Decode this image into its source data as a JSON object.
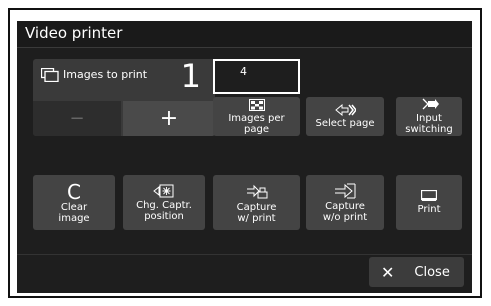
{
  "window": {
    "title": "Video printer"
  },
  "counter": {
    "label": "Images to print",
    "value": "1",
    "minus": "−",
    "plus": "+"
  },
  "images_per_page_value": "4",
  "buttons": {
    "images_per_page": "Images per\npage",
    "select_page": "Select page",
    "input_switching": "Input\nswitching",
    "clear_image_big": "C",
    "clear_image": "Clear\nimage",
    "chg_captr": "Chg. Captr.\nposition",
    "capture_print": "Capture\nw/ print",
    "capture_no_print": "Capture\nw/o print",
    "print": "Print"
  },
  "close": {
    "icon": "✕",
    "label": "Close"
  },
  "colors": {
    "panel": "#1e1e1e",
    "button": "#444444",
    "text": "#ffffff"
  }
}
